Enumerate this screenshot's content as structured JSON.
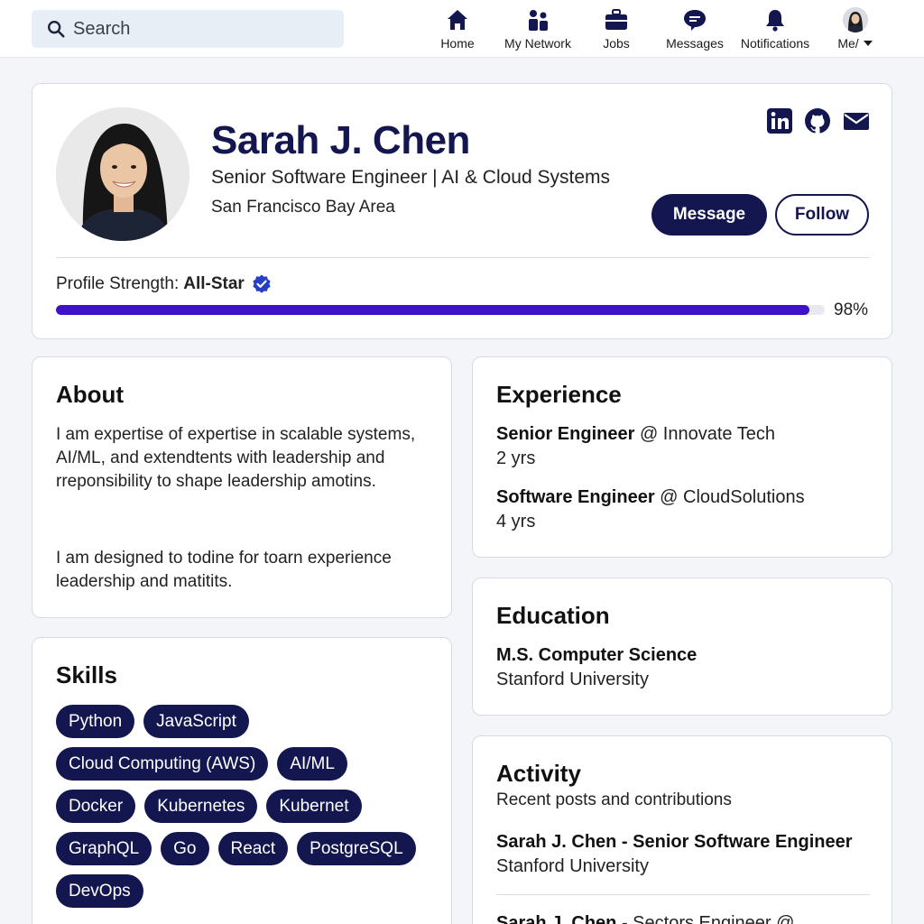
{
  "search": {
    "placeholder": "Search"
  },
  "nav": {
    "home": "Home",
    "network": "My Network",
    "jobs": "Jobs",
    "messages": "Messages",
    "notifications": "Notifications",
    "me": "Me/"
  },
  "profile": {
    "name": "Sarah J. Chen",
    "headline": "Senior Software Engineer | AI & Cloud Systems",
    "location": "San Francisco Bay Area",
    "message_label": "Message",
    "follow_label": "Follow",
    "strength_label": "Profile Strength:",
    "strength_value": "All-Star",
    "strength_percent_text": "98%",
    "strength_fraction": 0.98
  },
  "about": {
    "title": "About",
    "p1": "I am expertise of expertise in scalable systems, AI/ML, and extendtents with leadership and rreponsibility to shape leadership amotins.",
    "p2": "I am designed to todine for toarn experience leadership and matitits."
  },
  "skills": {
    "title": "Skills",
    "items": [
      "Python",
      "JavaScript",
      "Cloud Computing (AWS)",
      "AI/ML",
      "Docker",
      "Kubernetes",
      "Kubernet",
      "GraphQL",
      "Go",
      "React",
      "PostgreSQL",
      "DevOps"
    ]
  },
  "experience": {
    "title": "Experience",
    "items": [
      {
        "role": "Senior Engineer",
        "at": "@ Innovate Tech",
        "duration": "2 yrs"
      },
      {
        "role": "Software Engineer",
        "at": "@ CloudSolutions",
        "duration": "4 yrs"
      }
    ]
  },
  "education": {
    "title": "Education",
    "degree": "M.S. Computer Science",
    "school": "Stanford University"
  },
  "activity": {
    "title": "Activity",
    "subtitle": "Recent posts and contributions",
    "post1_author": "Sarah J. Chen - Senior Software Engineer",
    "post1_sub": "Stanford University",
    "post2_author": "Sarah J. Chen",
    "post2_rest": "- Sectors Engineer @"
  },
  "colors": {
    "navy": "#14174f",
    "progress": "#3d12c9",
    "verified": "#2540c4"
  },
  "icons": [
    "search-icon",
    "home-icon",
    "network-icon",
    "briefcase-icon",
    "message-bubble-icon",
    "bell-icon",
    "avatar",
    "chevron-down-icon",
    "linkedin-icon",
    "github-icon",
    "mail-icon",
    "verified-badge-icon"
  ]
}
